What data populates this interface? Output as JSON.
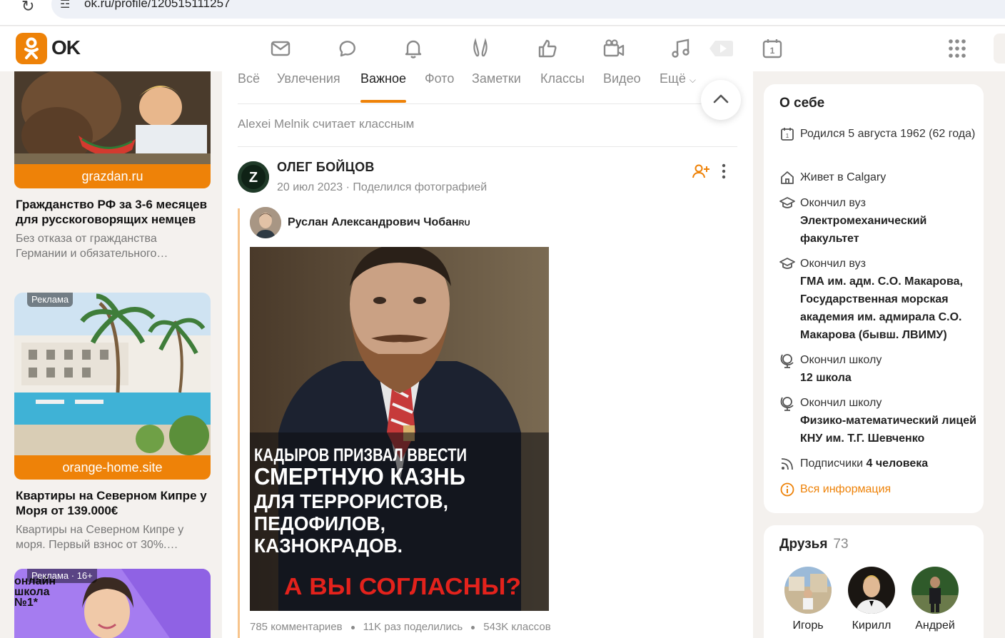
{
  "browser": {
    "url": "ok.ru/profile/120515111257",
    "reload_icon": "reload-icon",
    "site_info_icon": "tune-icon"
  },
  "header": {
    "logo_text": "OK",
    "brand_color": "#ee8208",
    "nav_icons": [
      "messages-icon",
      "discussions-icon",
      "notifications-icon",
      "guests-icon",
      "likes-icon",
      "video-call-icon",
      "music-icon",
      "video-icon",
      "calendar-icon",
      "apps-grid-icon"
    ],
    "calendar_badge": "1"
  },
  "left_ads": [
    {
      "domain": "grazdan.ru",
      "title": "Гражданство РФ за 3-6 месяцев\nдля русскоговорящих немцев",
      "description": "Без отказа от гражданства Германии и обязательного…"
    },
    {
      "badge": "Реклама",
      "domain": "orange-home.site",
      "title": "Квартиры на Северном Кипре у Моря от 139.000€",
      "description": "Квартиры на Северном Кипре у моря. Первый взнос от 30%.…"
    },
    {
      "badge": "Реклама · 16+",
      "image_text": "онлайн школа №1*"
    }
  ],
  "tabs": [
    {
      "label": "Всё",
      "active": false
    },
    {
      "label": "Увлечения",
      "active": false
    },
    {
      "label": "Важное",
      "active": true
    },
    {
      "label": "Фото",
      "active": false
    },
    {
      "label": "Заметки",
      "active": false
    },
    {
      "label": "Классы",
      "active": false
    },
    {
      "label": "Видео",
      "active": false
    },
    {
      "label": "Ещё",
      "active": false
    }
  ],
  "feed": {
    "liked_by": "Alexei Melnik считает классным",
    "post": {
      "author": "ОЛЕГ БОЙЦОВ",
      "avatar_letter": "Z",
      "meta": "20 июл 2023 · Поделился фотографией",
      "repost_author": "Руслан Александрович Чобан",
      "repost_author_suffix": "RU",
      "image_text": {
        "line1": "КАДЫРОВ ПРИЗВАЛ ВВЕСТИ",
        "line2": "СМЕРТНУЮ КАЗНЬ",
        "line3": "ДЛЯ ТЕРРОРИСТОВ,",
        "line4": "ПЕДОФИЛОВ,",
        "line5": "КАЗНОКРАДОВ.",
        "line6": "А ВЫ СОГЛАСНЫ?"
      },
      "stats": {
        "comments": "785 комментариев",
        "shares": "11K раз поделились",
        "likes": "543K классов"
      }
    }
  },
  "about": {
    "title": "О себе",
    "born": "Родился 5 августа 1962 (62 года)",
    "lives_label": "Живет в ",
    "lives_city": "Calgary",
    "uni1_label": "Окончил вуз",
    "uni1_name": "Электромеханический факультет",
    "uni2_label": "Окончил вуз",
    "uni2_name": "ГМА им. адм. С.О. Макарова, Государственная морская академия им. адмирала С.О. Макарова (бывш. ЛВИМУ)",
    "school1_label": "Окончил школу",
    "school1_name": "12 школа",
    "school2_label": "Окончил школу",
    "school2_name": "Физико-математический лицей КНУ им. Т.Г. Шевченко",
    "subscribers_label": "Подписчики ",
    "subscribers_value": "4 человека",
    "all_info": "Вся информация"
  },
  "friends": {
    "title": "Друзья",
    "count": "73",
    "items": [
      {
        "name": "Игорь"
      },
      {
        "name": "Кирилл"
      },
      {
        "name": "Андрей"
      }
    ]
  }
}
